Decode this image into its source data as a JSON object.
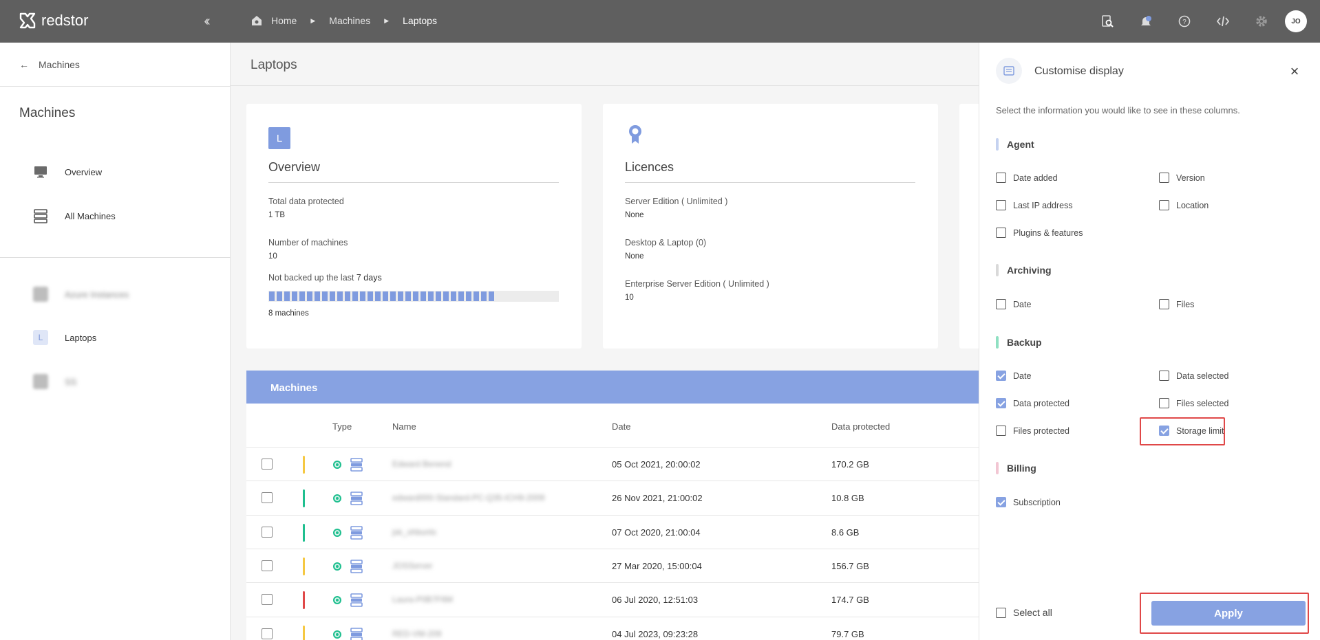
{
  "brand": {
    "name": "redstor"
  },
  "breadcrumb": {
    "items": [
      "Home",
      "Machines",
      "Laptops"
    ]
  },
  "user": {
    "initials": "JO"
  },
  "sidebar": {
    "back_label": "Machines",
    "title": "Machines",
    "nav": [
      {
        "label": "Overview",
        "icon": "monitor-icon"
      },
      {
        "label": "All Machines",
        "icon": "server-stack-icon"
      }
    ],
    "groups": [
      {
        "label": "Azure Instances",
        "blurred": true
      },
      {
        "label": "Laptops",
        "badge": "L",
        "blurred": false
      },
      {
        "label": "SS",
        "blurred": true
      }
    ]
  },
  "page": {
    "title": "Laptops"
  },
  "overview_card": {
    "badge": "L",
    "title": "Overview",
    "total_label": "Total data protected",
    "total_value": "1 TB",
    "machines_label": "Number of machines",
    "machines_value": "10",
    "not_backed_prefix": "Not backed up the last",
    "not_backed_days": "7 days",
    "not_backed_fraction": 0.8,
    "not_backed_value": "8 machines"
  },
  "licences_card": {
    "title": "Licences",
    "items": [
      {
        "label": "Server Edition ( Unlimited )",
        "value": "None"
      },
      {
        "label": "Desktop & Laptop (0)",
        "value": "None"
      },
      {
        "label": "Enterprise Server Edition ( Unlimited )",
        "value": "10"
      }
    ]
  },
  "machines_table": {
    "title": "Machines",
    "columns": [
      "Type",
      "Name",
      "Date",
      "Data protected"
    ],
    "rows": [
      {
        "status_color": "#f5c842",
        "name": "Edward Benend",
        "date": "05 Oct 2021, 20:00:02",
        "data_protected": "170.2 GB"
      },
      {
        "status_color": "#1fbf8f",
        "name": "edward000-Standard-PC-Q35-ICH9-2009",
        "date": "26 Nov 2021, 21:00:02",
        "data_protected": "10.8 GB"
      },
      {
        "status_color": "#1fbf8f",
        "name": "jsk_ohbunts",
        "date": "07 Oct 2020, 21:00:04",
        "data_protected": "8.6 GB"
      },
      {
        "status_color": "#f5c842",
        "name": "JOSServer",
        "date": "27 Mar 2020, 15:00:04",
        "data_protected": "156.7 GB"
      },
      {
        "status_color": "#e04848",
        "name": "Laura-P0B7F6M",
        "date": "06 Jul 2020, 12:51:03",
        "data_protected": "174.7 GB"
      },
      {
        "status_color": "#f5c842",
        "name": "RED-VM-209",
        "date": "04 Jul 2023, 09:23:28",
        "data_protected": "79.7 GB"
      }
    ]
  },
  "customise_panel": {
    "title": "Customise display",
    "description": "Select the information you would like to see in these columns.",
    "sections": {
      "agent": {
        "title": "Agent",
        "accent": "#c5d2f0"
      },
      "archiving": {
        "title": "Archiving",
        "accent": "#d9d9d9"
      },
      "backup": {
        "title": "Backup",
        "accent": "#8fe0c2"
      },
      "billing": {
        "title": "Billing",
        "accent": "#f2c6d3"
      }
    },
    "options": {
      "agent_date_added": {
        "label": "Date added",
        "checked": false
      },
      "agent_version": {
        "label": "Version",
        "checked": false
      },
      "agent_last_ip": {
        "label": "Last IP address",
        "checked": false
      },
      "agent_location": {
        "label": "Location",
        "checked": false
      },
      "agent_plugins": {
        "label": "Plugins & features",
        "checked": false
      },
      "archiving_date": {
        "label": "Date",
        "checked": false
      },
      "archiving_files": {
        "label": "Files",
        "checked": false
      },
      "backup_date": {
        "label": "Date",
        "checked": true
      },
      "backup_data_selected": {
        "label": "Data selected",
        "checked": false
      },
      "backup_data_protected": {
        "label": "Data protected",
        "checked": true
      },
      "backup_files_selected": {
        "label": "Files selected",
        "checked": false
      },
      "backup_files_protected": {
        "label": "Files protected",
        "checked": false
      },
      "backup_storage_limit": {
        "label": "Storage limit",
        "checked": true
      },
      "billing_subscription": {
        "label": "Subscription",
        "checked": true
      }
    },
    "select_all": {
      "label": "Select all",
      "checked": false
    },
    "apply_label": "Apply"
  },
  "colors": {
    "topbar": "#5f5f5f",
    "accent": "#87a2e2",
    "highlight": "#e04848"
  }
}
